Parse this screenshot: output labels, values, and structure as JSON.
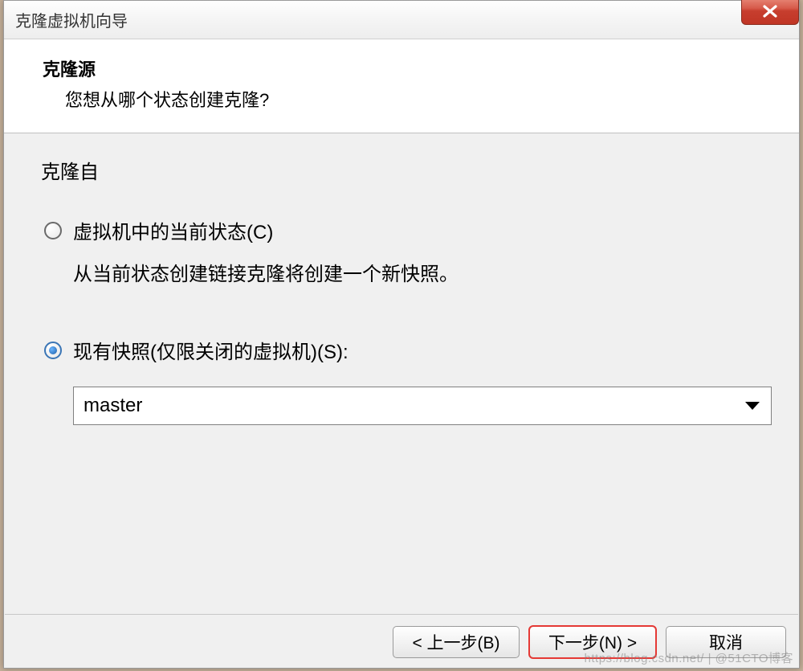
{
  "window": {
    "title": "克隆虚拟机向导"
  },
  "header": {
    "title": "克隆源",
    "subtitle": "您想从哪个状态创建克隆?"
  },
  "content": {
    "section_label": "克隆自",
    "option_current": {
      "label": "虚拟机中的当前状态(C)",
      "description": "从当前状态创建链接克隆将创建一个新快照。"
    },
    "option_snapshot": {
      "label": "现有快照(仅限关闭的虚拟机)(S):"
    },
    "dropdown": {
      "selected": "master"
    }
  },
  "buttons": {
    "back": "< 上一步(B)",
    "next": "下一步(N) >",
    "cancel": "取消"
  },
  "watermark": "https://blog.csdn.net/ | @51CTO博客"
}
